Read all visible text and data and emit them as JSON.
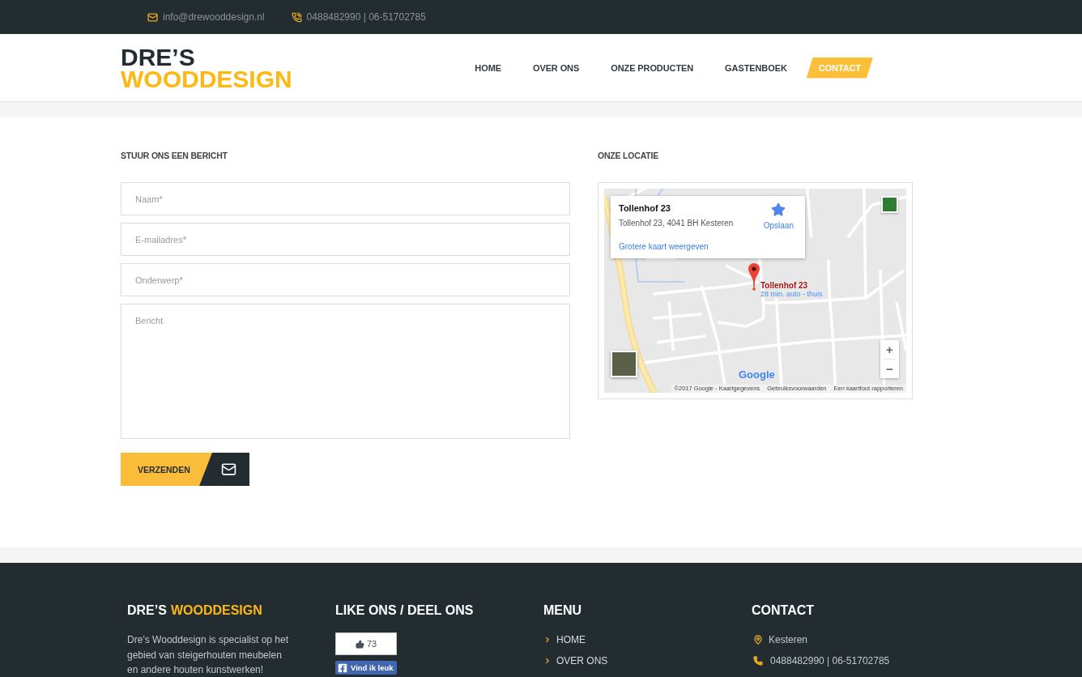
{
  "top_bar": {
    "email": "info@drewooddesign.nl",
    "phone": "0488482990 | 06-51702785"
  },
  "header": {
    "logo": {
      "line_1": "DRE’S",
      "line_2": "WOODDESIGN"
    },
    "nav": [
      {
        "label": "HOME",
        "selected": false
      },
      {
        "label": "OVER ONS",
        "selected": false
      },
      {
        "label": "ONZE PRODUCTEN",
        "selected": false
      },
      {
        "label": "GASTENBOEK",
        "selected": false
      },
      {
        "label": "CONTACT",
        "selected": true
      }
    ]
  },
  "contact_form": {
    "title": "STUUR ONS EEN BERICHT",
    "fields": [
      {
        "kind": "input",
        "placeholder": "Naam*"
      },
      {
        "kind": "input",
        "placeholder": "E-mailadres*"
      },
      {
        "kind": "input",
        "placeholder": "Onderwerp*"
      },
      {
        "kind": "textarea",
        "placeholder": "Bericht"
      }
    ],
    "submit": {
      "label": "VERZENDEN"
    }
  },
  "location": {
    "title": "ONZE LOCATIE",
    "map": {
      "info_card": {
        "title": "Tollenhof 23",
        "address": "Tollenhof 23, 4041 BH Kesteren",
        "save": "Opslaan",
        "larger_map_link": "Grotere kaart weergeven"
      },
      "marker": {
        "title": "Tollenhof 23",
        "route": "28 min. auto - thuis"
      },
      "zoom_in": "+",
      "zoom_out": "−",
      "logo": "Google",
      "attribution": [
        "©2017 Google - Kaartgegevens",
        "Gebruiksvoorwaarden",
        "Een kaartfout rapporteren"
      ]
    }
  },
  "footer": {
    "about": {
      "title": {
        "part_1": "DRE’S",
        "part_2": "WOODDESIGN"
      },
      "text": "Dre’s Wooddesign is specialist op het gebied van steigerhouten meubelen en andere houten kunstwerken!"
    },
    "social": {
      "title": "LIKE ONS / DEEL ONS",
      "like_count": "73",
      "like_button": "Vind ik leuk"
    },
    "menu": {
      "title": "MENU",
      "items": [
        "HOME",
        "OVER ONS"
      ]
    },
    "contact": {
      "title": "CONTACT",
      "items": [
        {
          "kind": "location",
          "text": "Kesteren"
        },
        {
          "kind": "phone",
          "text": "0488482990 | 06-51702785"
        }
      ]
    }
  }
}
